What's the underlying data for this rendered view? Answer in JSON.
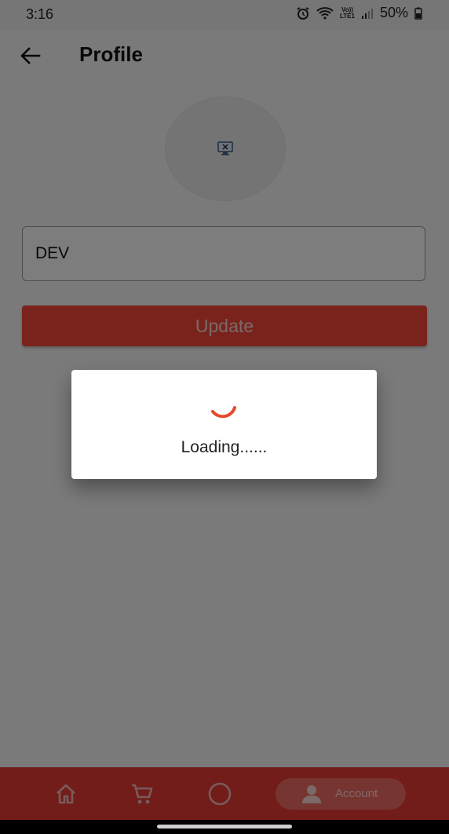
{
  "status_bar": {
    "time": "3:16",
    "battery": "50%",
    "network_top": "Vo))",
    "network_bottom": "LTE1"
  },
  "header": {
    "title": "Profile",
    "back_icon": "arrow-left-icon"
  },
  "profile": {
    "avatar_icon": "broken-image-icon",
    "name_value": "DEV"
  },
  "actions": {
    "update_label": "Update"
  },
  "dialog": {
    "loading_label": "Loading......",
    "spinner_color": "#e64a2e"
  },
  "bottom_nav": {
    "items": [
      "home-icon",
      "cart-icon",
      "circle-icon",
      "account-icon"
    ],
    "account_label": "Account",
    "background": "#e53b34",
    "active_pill": "#ee6a63"
  },
  "colors": {
    "accent": "#f4463a",
    "scrim": "rgba(0,0,0,0.5)"
  }
}
